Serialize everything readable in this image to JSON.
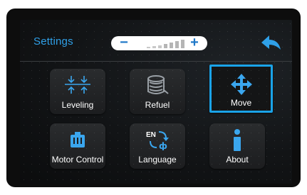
{
  "header": {
    "title": "Settings",
    "volume": {
      "minus": "−",
      "plus": "+",
      "level_steps": 7,
      "level_filled": 4
    }
  },
  "menu": [
    {
      "id": "leveling",
      "label": "Leveling",
      "icon": "leveling-icon"
    },
    {
      "id": "refuel",
      "label": "Refuel",
      "icon": "filament-spool-icon"
    },
    {
      "id": "move",
      "label": "Move",
      "icon": "move-arrows-icon",
      "selected": true
    },
    {
      "id": "motor-control",
      "label": "Motor Control",
      "icon": "motor-icon"
    },
    {
      "id": "language",
      "label": "Language",
      "icon": "language-icon",
      "icon_text": "EN"
    },
    {
      "id": "about",
      "label": "About",
      "icon": "info-icon",
      "icon_text": "i"
    }
  ],
  "colors": {
    "accent": "#2fa0e8",
    "selected_border": "#1aa3e8",
    "icon_blue": "#3aa6ee"
  }
}
